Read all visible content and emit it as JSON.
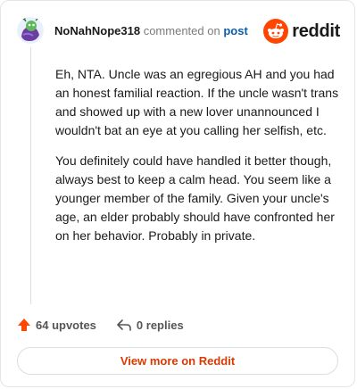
{
  "comment": {
    "author": "NoNahNope318",
    "verb": "commented on",
    "target": "post",
    "paragraphs": [
      "Eh, NTA. Uncle was an egregious AH and you had an honest familial reaction. If the uncle wasn't trans and showed up with a new lover unannounced I wouldn't bat an eye at you calling her selfish, etc.",
      "You definitely could have handled it better though, always best to keep a calm head. You seem like a younger member of the family. Given your uncle's age, an elder probably should have confronted her on her behavior. Probably in private."
    ]
  },
  "brand": {
    "wordmark": "reddit",
    "color": "#ff4500"
  },
  "actions": {
    "upvotes": "64 upvotes",
    "replies": "0 replies"
  },
  "cta": {
    "label": "View more on Reddit"
  },
  "icons": {
    "avatar": "snoo-avatar-icon",
    "logo": "reddit-logo-icon",
    "upvote": "upvote-arrow-icon",
    "reply": "reply-arrow-icon"
  }
}
